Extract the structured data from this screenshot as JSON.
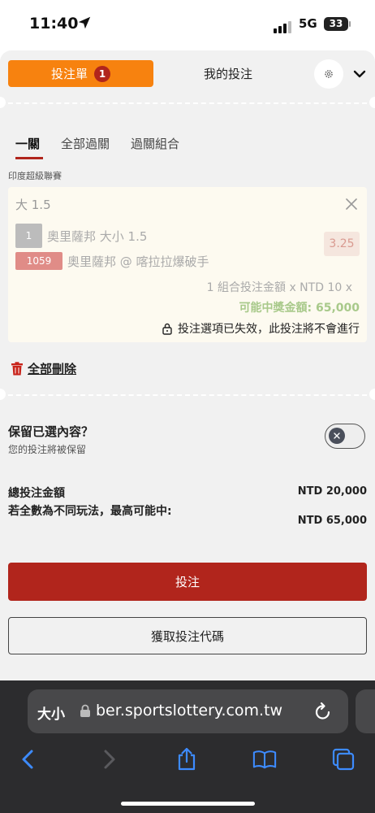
{
  "status_bar": {
    "time": "11:40",
    "network": "5G",
    "battery": "33"
  },
  "header": {
    "betslip_label": "投注單",
    "betslip_count": "1",
    "mybets_label": "我的投注"
  },
  "bet_type_tabs": [
    "一關",
    "全部過關",
    "過關組合"
  ],
  "league": "印度超級聯賽",
  "bet_card": {
    "title": "大 1.5",
    "selection_badge": "1",
    "selection_text": "奧里薩邦 大小 1.5",
    "odds": "3.25",
    "match_id": "1059",
    "match_text": "奧里薩邦 @ 喀拉拉爆破手",
    "stake_line": "1 組合投注金額 x NTD 10 x",
    "potential_win": "可能中獎金額: 65,000",
    "invalid_notice": "投注選項已失效，此投注將不會進行"
  },
  "delete_all_label": "全部刪除",
  "retain": {
    "title": "保留已選內容？",
    "subtitle": "您的投注將被保留",
    "enabled": false
  },
  "summary": {
    "total_label": "總投注金額",
    "total_value": "NTD 20,000",
    "max_win_label": "若全數為不同玩法，最高可能中:",
    "max_win_value": "NTD 65,000"
  },
  "bet_button_label": "投注",
  "code_button_label": "獲取投注代碼",
  "browser": {
    "text_size_label": "大小",
    "url": "ber.sportslottery.com.tw"
  },
  "colors": {
    "accent_orange": "#f7820f",
    "accent_red": "#b1251c",
    "win_green": "#a8c98a"
  },
  "icons": [
    "location-arrow-icon",
    "signal-icon",
    "battery-icon",
    "settings-icon",
    "chevron-down-icon",
    "close-icon",
    "lock-icon",
    "trash-icon",
    "reload-icon",
    "back-icon",
    "forward-icon",
    "share-icon",
    "bookmarks-icon",
    "tabs-icon"
  ]
}
